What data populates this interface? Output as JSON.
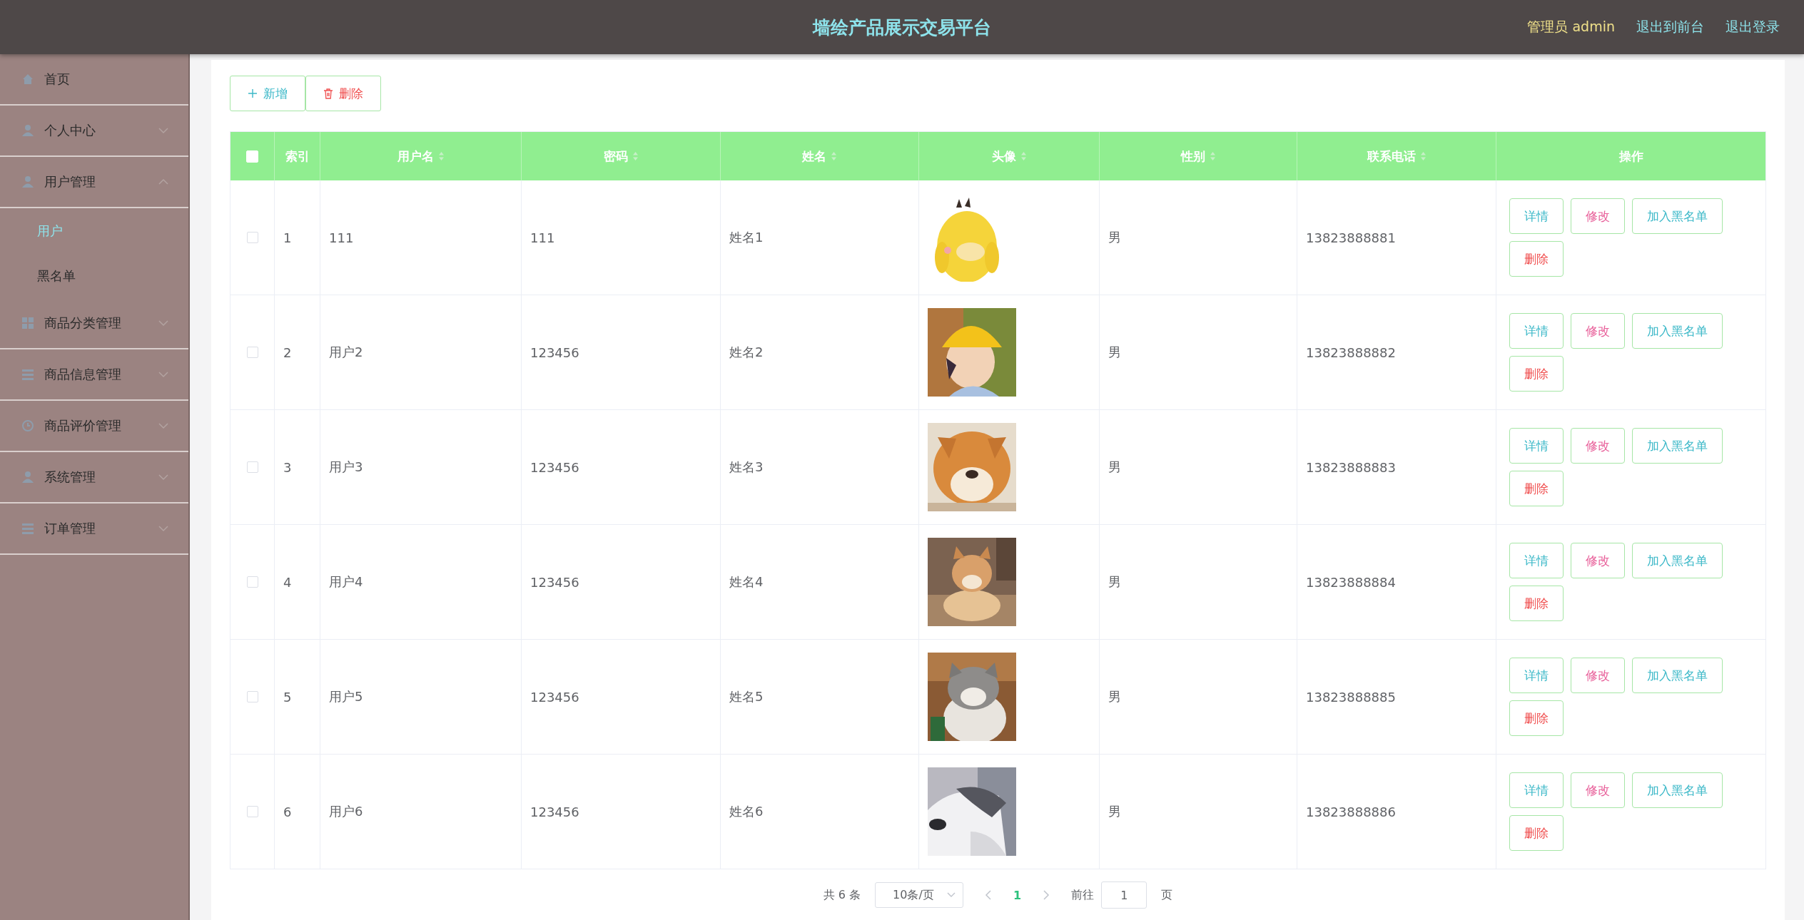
{
  "header": {
    "title": "墙绘产品展示交易平台",
    "user": "管理员 admin",
    "links": [
      "退出到前台",
      "退出登录"
    ]
  },
  "sidebar": {
    "items": [
      {
        "label": "首页"
      },
      {
        "label": "个人中心",
        "expanded": false
      },
      {
        "label": "用户管理",
        "expanded": true,
        "children": [
          {
            "label": "用户",
            "selected": true
          },
          {
            "label": "黑名单",
            "selected": false
          }
        ]
      },
      {
        "label": "商品分类管理",
        "expanded": false
      },
      {
        "label": "商品信息管理",
        "expanded": false
      },
      {
        "label": "商品评价管理",
        "expanded": false
      },
      {
        "label": "系统管理",
        "expanded": false
      },
      {
        "label": "订单管理",
        "expanded": false
      }
    ]
  },
  "toolbar": [
    {
      "label": "新增",
      "kind": "add"
    },
    {
      "label": "删除",
      "kind": "delete"
    }
  ],
  "table": {
    "select_all": {
      "checked": false
    },
    "columns": [
      {
        "label": "索引",
        "sortable": false
      },
      {
        "label": "用户名",
        "sortable": true
      },
      {
        "label": "密码",
        "sortable": true
      },
      {
        "label": "姓名",
        "sortable": true
      },
      {
        "label": "头像",
        "sortable": true
      },
      {
        "label": "性别",
        "sortable": true
      },
      {
        "label": "联系电话",
        "sortable": true
      },
      {
        "label": "操作",
        "sortable": false
      }
    ],
    "rows": [
      {
        "checked": false,
        "index": "1",
        "username": "111",
        "password": "111",
        "name": "姓名1",
        "gender": "男",
        "phone": "13823888881",
        "actions": [
          {
            "label": "详情",
            "kind": "detail"
          },
          {
            "label": "修改",
            "kind": "edit"
          },
          {
            "label": "加入黑名单",
            "kind": "blacklist"
          },
          {
            "label": "删除",
            "kind": "delete"
          }
        ]
      },
      {
        "checked": false,
        "index": "2",
        "username": "用户2",
        "password": "123456",
        "name": "姓名2",
        "gender": "男",
        "phone": "13823888882",
        "actions": [
          {
            "label": "详情",
            "kind": "detail"
          },
          {
            "label": "修改",
            "kind": "edit"
          },
          {
            "label": "加入黑名单",
            "kind": "blacklist"
          },
          {
            "label": "删除",
            "kind": "delete"
          }
        ]
      },
      {
        "checked": false,
        "index": "3",
        "username": "用户3",
        "password": "123456",
        "name": "姓名3",
        "gender": "男",
        "phone": "13823888883",
        "actions": [
          {
            "label": "详情",
            "kind": "detail"
          },
          {
            "label": "修改",
            "kind": "edit"
          },
          {
            "label": "加入黑名单",
            "kind": "blacklist"
          },
          {
            "label": "删除",
            "kind": "delete"
          }
        ]
      },
      {
        "checked": false,
        "index": "4",
        "username": "用户4",
        "password": "123456",
        "name": "姓名4",
        "gender": "男",
        "phone": "13823888884",
        "actions": [
          {
            "label": "详情",
            "kind": "detail"
          },
          {
            "label": "修改",
            "kind": "edit"
          },
          {
            "label": "加入黑名单",
            "kind": "blacklist"
          },
          {
            "label": "删除",
            "kind": "delete"
          }
        ]
      },
      {
        "checked": false,
        "index": "5",
        "username": "用户5",
        "password": "123456",
        "name": "姓名5",
        "gender": "男",
        "phone": "13823888885",
        "actions": [
          {
            "label": "详情",
            "kind": "detail"
          },
          {
            "label": "修改",
            "kind": "edit"
          },
          {
            "label": "加入黑名单",
            "kind": "blacklist"
          },
          {
            "label": "删除",
            "kind": "delete"
          }
        ]
      },
      {
        "checked": false,
        "index": "6",
        "username": "用户6",
        "password": "123456",
        "name": "姓名6",
        "gender": "男",
        "phone": "13823888886",
        "actions": [
          {
            "label": "详情",
            "kind": "detail"
          },
          {
            "label": "修改",
            "kind": "edit"
          },
          {
            "label": "加入黑名单",
            "kind": "blacklist"
          },
          {
            "label": "删除",
            "kind": "delete"
          }
        ]
      }
    ]
  },
  "pagination": {
    "total": "共 6 条",
    "page_size": "10条/页",
    "pages": [
      {
        "label": "1",
        "selected": true
      }
    ],
    "goto_label": "前往",
    "goto_value": "1",
    "page_unit": "页"
  }
}
